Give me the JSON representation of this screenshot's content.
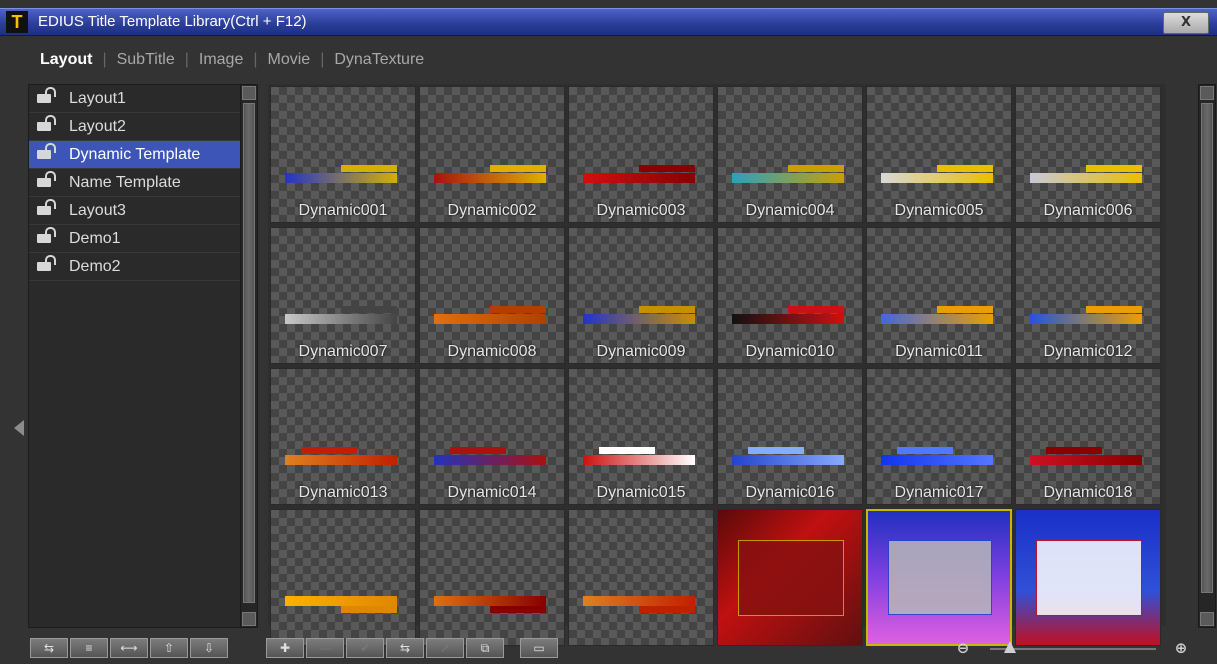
{
  "window": {
    "title": "EDIUS Title Template Library(Ctrl + F12)",
    "app_icon": "T",
    "close_glyph": "X"
  },
  "tabs": [
    {
      "label": "Layout",
      "active": true
    },
    {
      "label": "SubTitle",
      "active": false
    },
    {
      "label": "Image",
      "active": false
    },
    {
      "label": "Movie",
      "active": false
    },
    {
      "label": "DynaTexture",
      "active": false
    }
  ],
  "tree": {
    "items": [
      {
        "label": "Layout1",
        "selected": false
      },
      {
        "label": "Layout2",
        "selected": false
      },
      {
        "label": "Dynamic Template",
        "selected": true
      },
      {
        "label": "Name Template",
        "selected": false
      },
      {
        "label": "Layout3",
        "selected": false
      },
      {
        "label": "Demo1",
        "selected": false
      },
      {
        "label": "Demo2",
        "selected": false
      }
    ]
  },
  "templates": [
    {
      "label": "Dynamic001",
      "accent": "#2233cc",
      "accent2": "#d4b000"
    },
    {
      "label": "Dynamic002",
      "accent": "#aa1111",
      "accent2": "#e0b000"
    },
    {
      "label": "Dynamic003",
      "accent": "#cc1111",
      "accent2": "#8a0000"
    },
    {
      "label": "Dynamic004",
      "accent": "#2aa0c0",
      "accent2": "#c8a000"
    },
    {
      "label": "Dynamic005",
      "accent": "#d8d8d8",
      "accent2": "#e8c000"
    },
    {
      "label": "Dynamic006",
      "accent": "#c8c8d8",
      "accent2": "#e8c000"
    },
    {
      "label": "Dynamic007",
      "accent": "#c8c8c8",
      "accent2": "#444444"
    },
    {
      "label": "Dynamic008",
      "accent": "#e07010",
      "accent2": "#b04000"
    },
    {
      "label": "Dynamic009",
      "accent": "#2233cc",
      "accent2": "#c89000"
    },
    {
      "label": "Dynamic010",
      "accent": "#111111",
      "accent2": "#cc1111"
    },
    {
      "label": "Dynamic011",
      "accent": "#4466dd",
      "accent2": "#e8a000"
    },
    {
      "label": "Dynamic012",
      "accent": "#2255dd",
      "accent2": "#e8a000"
    },
    {
      "label": "Dynamic013",
      "accent": "#e08020",
      "accent2": "#c02000"
    },
    {
      "label": "Dynamic014",
      "accent": "#2233bb",
      "accent2": "#aa1111"
    },
    {
      "label": "Dynamic015",
      "accent": "#cc1111",
      "accent2": "#ffffff"
    },
    {
      "label": "Dynamic016",
      "accent": "#2244cc",
      "accent2": "#88aaff"
    },
    {
      "label": "Dynamic017",
      "accent": "#1133ee",
      "accent2": "#5577ff"
    },
    {
      "label": "Dynamic018",
      "accent": "#cc1122",
      "accent2": "#880000"
    },
    {
      "label": "",
      "accent": "#ffb000",
      "accent2": "#dd8800"
    },
    {
      "label": "",
      "accent": "#e07010",
      "accent2": "#880000"
    },
    {
      "label": "",
      "accent": "#e08020",
      "accent2": "#c02000"
    },
    {
      "label": "",
      "accent": "#881010",
      "accent2": "#d0b000",
      "full": true,
      "bg": "linear-gradient(135deg,#5a0a0a,#c01010 40%,#601010)"
    },
    {
      "label": "",
      "accent": "#b8b8b8",
      "accent2": "#2244cc",
      "full": true,
      "bg": "linear-gradient(180deg,#2030c0,#8040e0 50%,#e060e0)",
      "selected": true
    },
    {
      "label": "",
      "accent": "#ffffff",
      "accent2": "#cc1111",
      "full": true,
      "bg": "linear-gradient(180deg,#1a30c8,#3050d8 60%,#c01020)"
    }
  ],
  "toolbar_left": [
    "⇆",
    "≡",
    "⟷",
    "⇧",
    "⇩"
  ],
  "toolbar_right": [
    "✚",
    "—",
    "✔",
    "⇆",
    "↗",
    "⧉",
    "▭"
  ],
  "zoom": {
    "level_fraction": 0.12,
    "out_glyph": "⊖",
    "in_glyph": "⊕"
  }
}
